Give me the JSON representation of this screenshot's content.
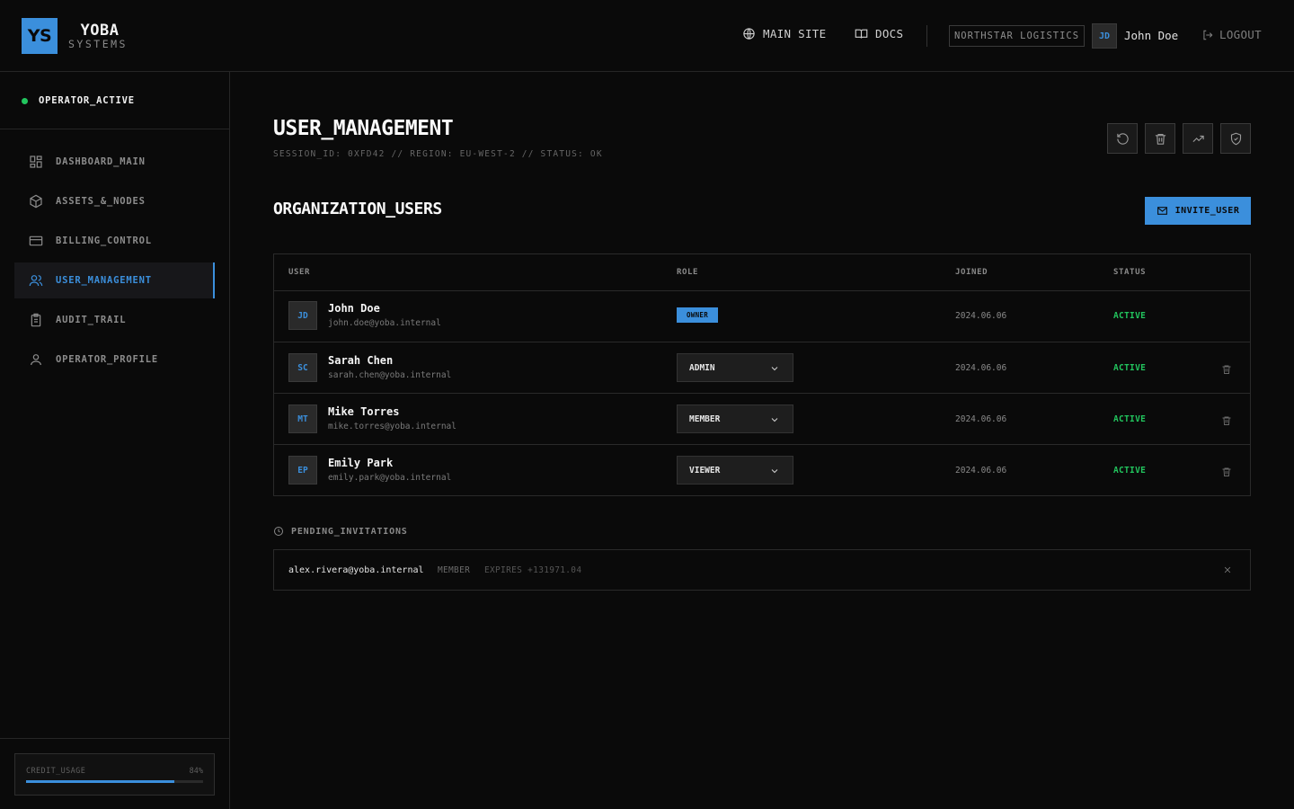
{
  "brand": {
    "initials": "YS",
    "name": "YOBA",
    "sub": "SYSTEMS"
  },
  "header": {
    "main_site": "MAIN SITE",
    "docs": "DOCS",
    "org": "NORTHSTAR LOGISTICS",
    "user_initials": "JD",
    "user_name": "John Doe",
    "logout": "LOGOUT"
  },
  "sidebar": {
    "status": "OPERATOR_ACTIVE",
    "status_color": "#22c55e",
    "items": [
      {
        "label": "DASHBOARD_MAIN",
        "icon": "dashboard-icon",
        "active": false
      },
      {
        "label": "ASSETS_&_NODES",
        "icon": "box-icon",
        "active": false
      },
      {
        "label": "BILLING_CONTROL",
        "icon": "credit-card-icon",
        "active": false
      },
      {
        "label": "USER_MANAGEMENT",
        "icon": "users-icon",
        "active": true
      },
      {
        "label": "AUDIT_TRAIL",
        "icon": "clipboard-icon",
        "active": false
      },
      {
        "label": "OPERATOR_PROFILE",
        "icon": "user-icon",
        "active": false
      }
    ],
    "credit": {
      "label": "CREDIT_USAGE",
      "percent_label": "84%",
      "percent": 84
    }
  },
  "page": {
    "title": "USER_MANAGEMENT",
    "subtitle": "SESSION_ID: 0XFD42 // REGION: EU-WEST-2 // STATUS: OK",
    "section_title": "ORGANIZATION_USERS",
    "invite_label": "INVITE_USER"
  },
  "table": {
    "headers": {
      "user": "USER",
      "role": "ROLE",
      "joined": "JOINED",
      "status": "STATUS"
    },
    "rows": [
      {
        "initials": "JD",
        "name": "John Doe",
        "email": "john.doe@yoba.internal",
        "role": "OWNER",
        "joined": "2024.06.06",
        "status": "ACTIVE"
      },
      {
        "initials": "SC",
        "name": "Sarah Chen",
        "email": "sarah.chen@yoba.internal",
        "role": "ADMIN",
        "joined": "2024.06.06",
        "status": "ACTIVE"
      },
      {
        "initials": "MT",
        "name": "Mike Torres",
        "email": "mike.torres@yoba.internal",
        "role": "MEMBER",
        "joined": "2024.06.06",
        "status": "ACTIVE"
      },
      {
        "initials": "EP",
        "name": "Emily Park",
        "email": "emily.park@yoba.internal",
        "role": "VIEWER",
        "joined": "2024.06.06",
        "status": "ACTIVE"
      }
    ]
  },
  "pending": {
    "title": "PENDING_INVITATIONS",
    "items": [
      {
        "email": "alex.rivera@yoba.internal",
        "role": "MEMBER",
        "expires": "EXPIRES +131971.04"
      }
    ]
  },
  "colors": {
    "accent": "#3b8fdc",
    "active": "#22c55e",
    "background": "#0a0a0a"
  }
}
